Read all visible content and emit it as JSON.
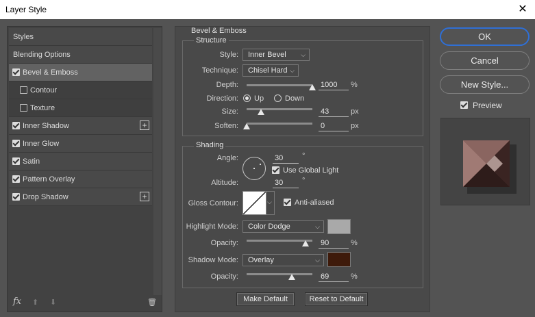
{
  "window": {
    "title": "Layer Style",
    "close_glyph": "✕"
  },
  "styles_panel": {
    "items": [
      {
        "label": "Styles",
        "checkbox": null,
        "plus": false
      },
      {
        "label": "Blending Options",
        "checkbox": null,
        "plus": false
      },
      {
        "label": "Bevel & Emboss",
        "checkbox": true,
        "plus": false,
        "selected": true
      },
      {
        "label": "Contour",
        "checkbox": false,
        "plus": false,
        "sub": true
      },
      {
        "label": "Texture",
        "checkbox": false,
        "plus": false,
        "sub": true
      },
      {
        "label": "Inner Shadow",
        "checkbox": true,
        "plus": true
      },
      {
        "label": "Inner Glow",
        "checkbox": true,
        "plus": false
      },
      {
        "label": "Satin",
        "checkbox": true,
        "plus": false
      },
      {
        "label": "Pattern Overlay",
        "checkbox": true,
        "plus": false
      },
      {
        "label": "Drop Shadow",
        "checkbox": true,
        "plus": true
      }
    ],
    "footer": {
      "fx": "fx",
      "up": "⬆",
      "down": "⬇",
      "trash": "🗑"
    },
    "plus_glyph": "+"
  },
  "bevel": {
    "heading": "Bevel & Emboss",
    "structure": {
      "heading": "Structure",
      "style_label": "Style:",
      "style_value": "Inner Bevel",
      "technique_label": "Technique:",
      "technique_value": "Chisel Hard",
      "depth_label": "Depth:",
      "depth_value": "1000",
      "depth_unit": "%",
      "depth_level": 1.0,
      "direction_label": "Direction:",
      "dir_up": "Up",
      "dir_down": "Down",
      "size_label": "Size:",
      "size_value": "43",
      "size_unit": "px",
      "size_level": 0.22,
      "soften_label": "Soften:",
      "soften_value": "0",
      "soften_unit": "px",
      "soften_level": 0.0
    },
    "shading": {
      "heading": "Shading",
      "angle_label": "Angle:",
      "angle_value": "30",
      "degree": "°",
      "global_light_label": "Use Global Light",
      "altitude_label": "Altitude:",
      "altitude_value": "30",
      "gloss_label": "Gloss Contour:",
      "antialiased_label": "Anti-aliased",
      "highlight_label": "Highlight Mode:",
      "highlight_value": "Color Dodge",
      "highlight_color": "#a9a9a9",
      "opacity1_label": "Opacity:",
      "opacity1_value": "90",
      "opacity1_level": 0.9,
      "shadow_label": "Shadow Mode:",
      "shadow_value": "Overlay",
      "shadow_color": "#3e1a0a",
      "opacity2_label": "Opacity:",
      "opacity2_value": "69",
      "opacity2_level": 0.69,
      "percent": "%"
    },
    "make_default": "Make Default",
    "reset_default": "Reset to Default"
  },
  "actions": {
    "ok": "OK",
    "cancel": "Cancel",
    "new_style": "New Style...",
    "preview_label": "Preview",
    "dropdown_arrow": "⌵"
  }
}
